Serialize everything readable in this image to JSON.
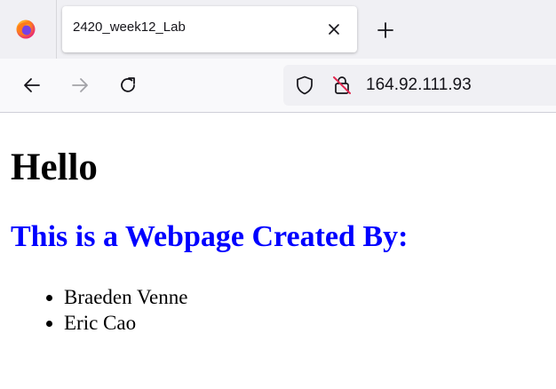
{
  "browser": {
    "tab": {
      "title": "2420_week12_Lab"
    },
    "address_bar": {
      "url": "164.92.111.93"
    },
    "icons": {
      "app": "firefox-logo-icon",
      "close": "close-icon",
      "new_tab": "plus-icon",
      "back": "back-arrow-icon",
      "forward": "forward-arrow-icon",
      "reload": "reload-icon",
      "tracking": "shield-icon",
      "security": "insecure-lock-icon"
    }
  },
  "page": {
    "heading": "Hello",
    "subheading": "This is a Webpage Created By:",
    "subheading_color": "#0000ff",
    "authors": [
      "Braeden Venne",
      "Eric Cao"
    ]
  }
}
